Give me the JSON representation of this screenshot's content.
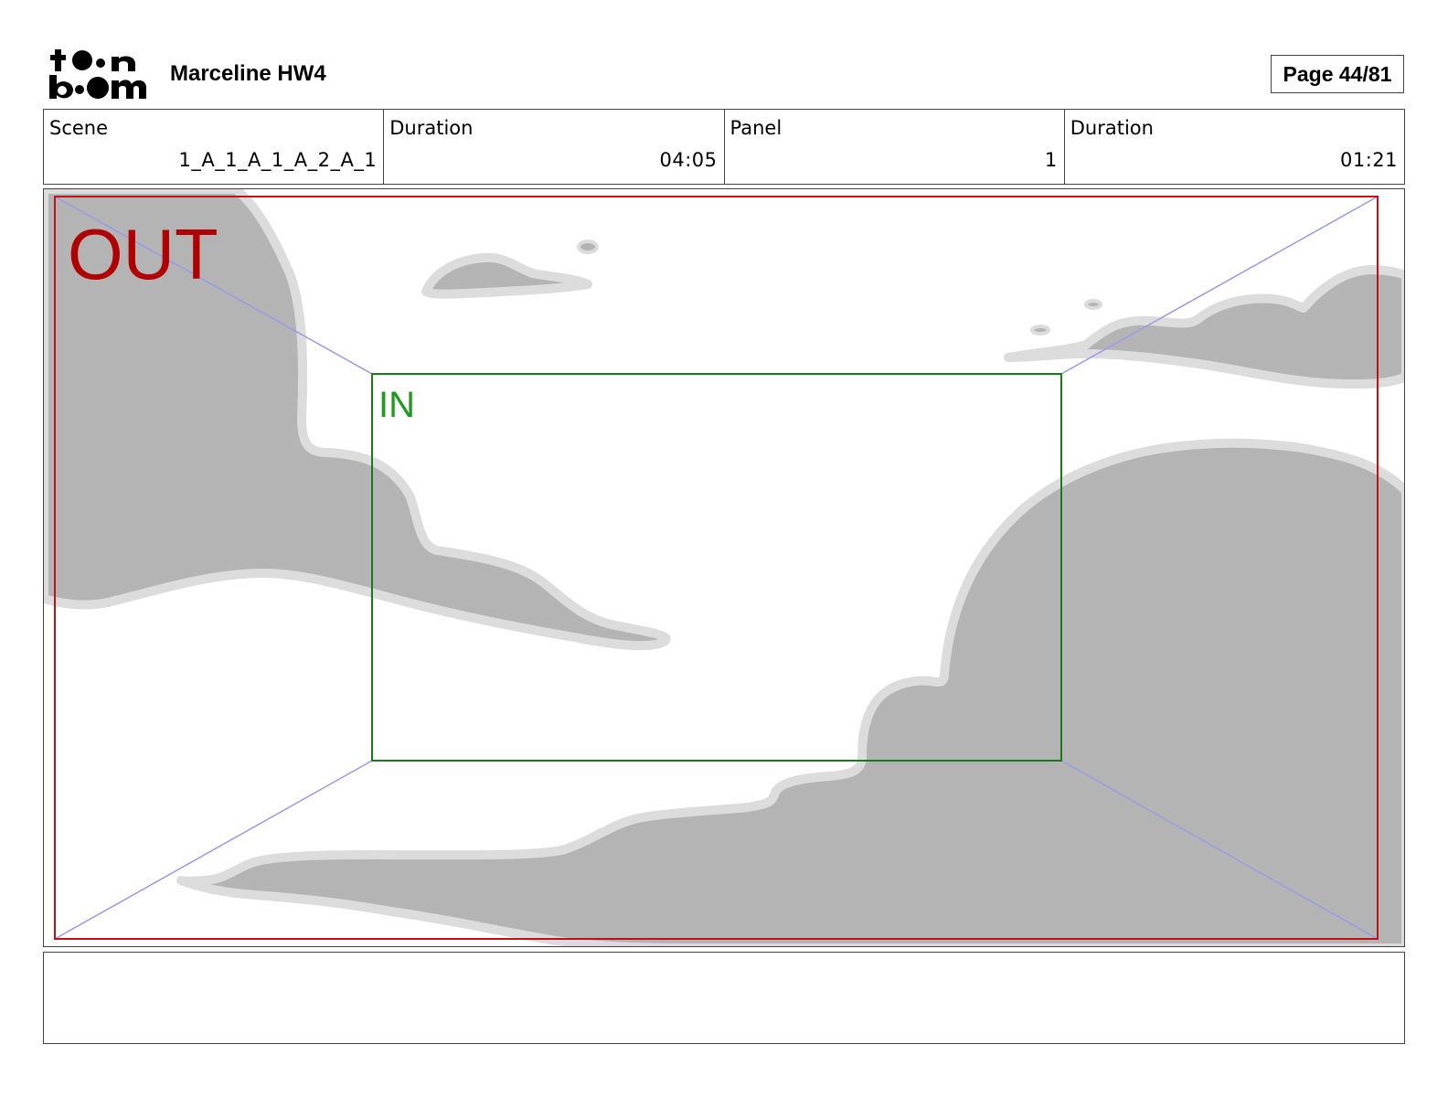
{
  "header": {
    "logo_text": "toonboom",
    "title": "Marceline HW4",
    "page_label": "Page 44/81"
  },
  "info": {
    "scene_label": "Scene",
    "scene_value": "1_A_1_A_1_A_2_A_1",
    "scene_duration_label": "Duration",
    "scene_duration_value": "04:05",
    "panel_label": "Panel",
    "panel_value": "1",
    "panel_duration_label": "Duration",
    "panel_duration_value": "01:21"
  },
  "panel": {
    "out_label": "OUT",
    "in_label": "IN",
    "colors": {
      "out_frame": "#c0101a",
      "in_frame": "#1a7a1a",
      "guide_lines": "#9a9ae6",
      "cloud_fill": "#b4b4b4",
      "cloud_outline": "#dcdcdc"
    }
  },
  "notes": {
    "text": ""
  }
}
